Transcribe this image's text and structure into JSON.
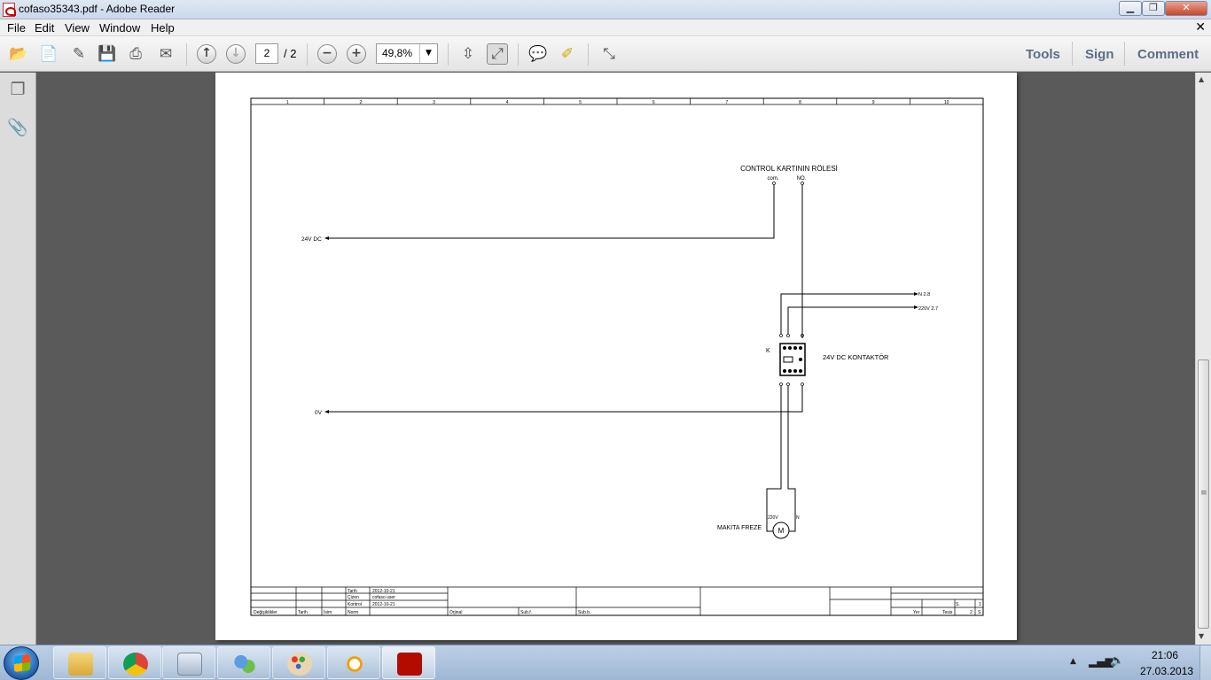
{
  "window": {
    "title": "cofaso35343.pdf - Adobe Reader"
  },
  "menu": {
    "items": [
      "File",
      "Edit",
      "View",
      "Window",
      "Help"
    ],
    "close_doc": "✕"
  },
  "toolbar": {
    "page_current": "2",
    "page_total": "/ 2",
    "zoom": "49,8%",
    "right_links": [
      "Tools",
      "Sign",
      "Comment"
    ]
  },
  "schematic": {
    "column_numbers": [
      "1",
      "2",
      "3",
      "4",
      "5",
      "6",
      "7",
      "8",
      "9",
      "10"
    ],
    "relay_title": "CONTROL KARTININ RÖLESİ",
    "relay_com": "com.",
    "relay_no": "NO.",
    "supply_24v": "24V DC",
    "supply_0v": "0V",
    "out_n": "N 2.8",
    "out_220v": "220V 2.7",
    "contactor_tag": "K",
    "contactor_label": "24V DC KONTAKTÖR",
    "motor_label": "MAKİTA  FREZE",
    "motor_symbol": "M",
    "motor_220v": "220V",
    "motor_n": "N",
    "tb_tarih_label": "Tarih",
    "tb_tarih_value": "2012-10-21",
    "tb_cizen_label": "Çizen",
    "tb_cizen_value": "cofaso user",
    "tb_kontrol_label": "Kontrol",
    "tb_kontrol_value": "2012-10-21",
    "tb_degisiklikler": "Değişiklikler",
    "tb_tarih2": "Tarih",
    "tb_isim": "İsim",
    "tb_norm": "Norm",
    "tb_orjinal": "Orjinal",
    "tb_subf": "Sub.f.",
    "tb_subb": "Sub.b.",
    "tb_yer": "Yer",
    "tb_tesis": "Tesis",
    "tb_s": "S.",
    "tb_page": "2",
    "tb_sheets": "1",
    "tb_s2": "S"
  },
  "taskbar": {
    "apps": [
      "explorer",
      "chrome",
      "calculator",
      "network-users",
      "paint",
      "sun-app",
      "adobe-reader"
    ],
    "time": "21:06",
    "date": "27.03.2013"
  },
  "colors": {
    "titlebar": "#c9d8ea",
    "doc_bg": "#5a5a5a",
    "adobe_red": "#b30b00"
  }
}
